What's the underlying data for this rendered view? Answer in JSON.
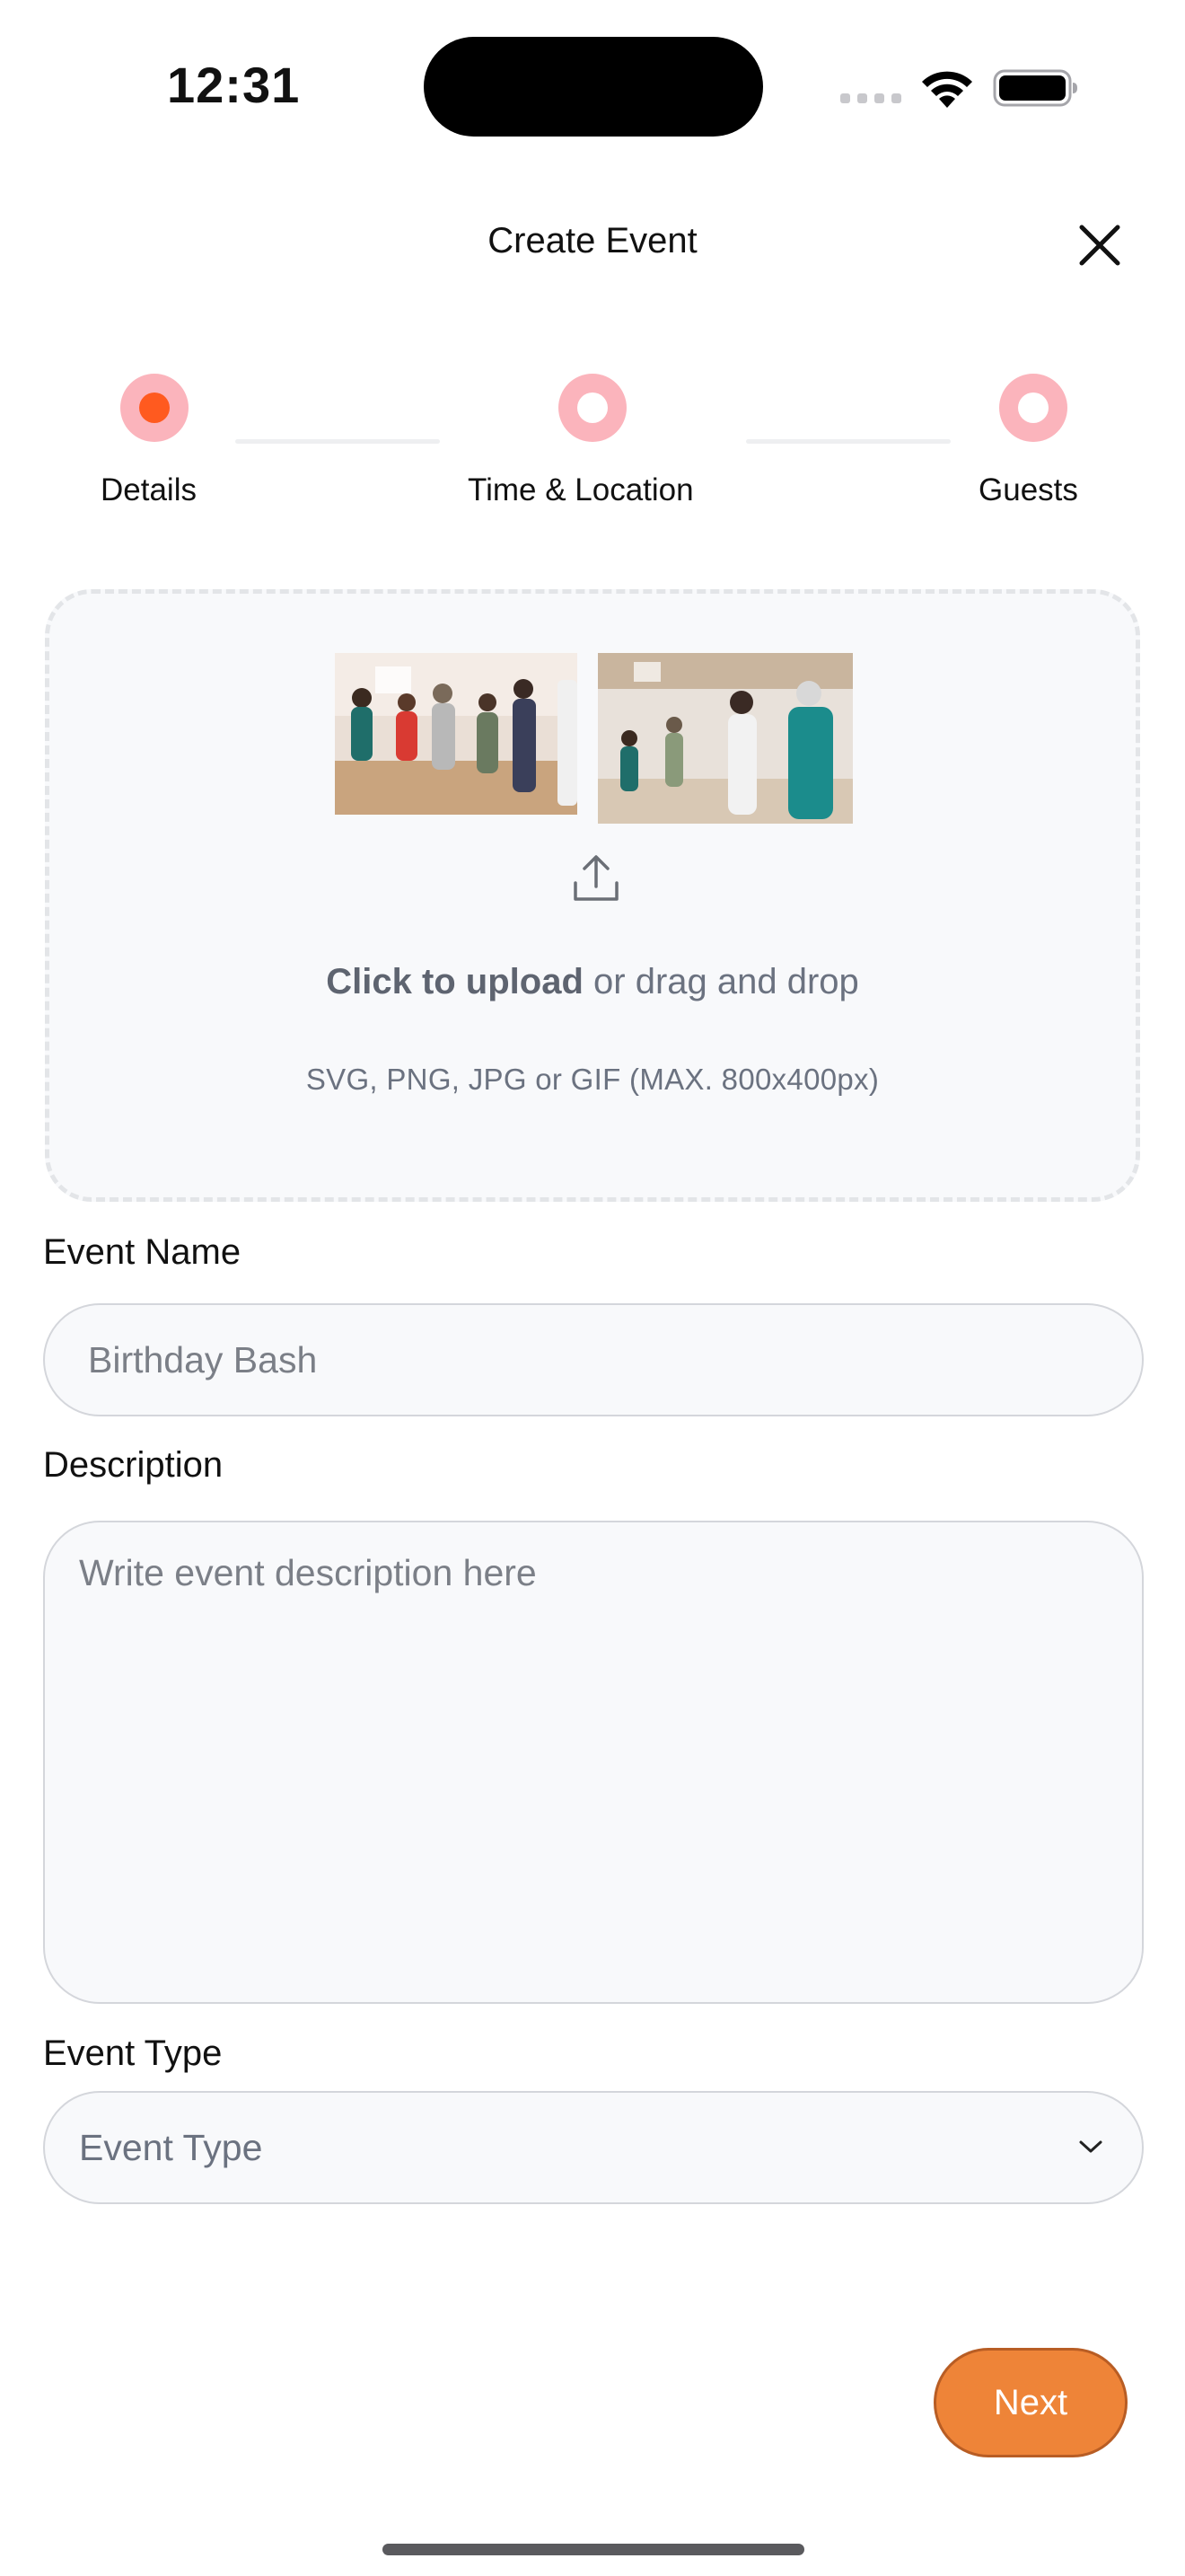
{
  "status_bar": {
    "time": "12:31"
  },
  "header": {
    "title": "Create Event",
    "close_icon": "close-icon"
  },
  "stepper": {
    "steps": [
      {
        "label": "Details",
        "state": "active"
      },
      {
        "label": "Time & Location",
        "state": "pending"
      },
      {
        "label": "Guests",
        "state": "pending"
      }
    ],
    "active_color": "#ff5a1f",
    "ring_color": "#fbb4bc"
  },
  "upload": {
    "primary_bold": "Click to upload",
    "primary_rest": " or drag and drop",
    "hint": "SVG, PNG, JPG or GIF (MAX. 800x400px)",
    "icon": "upload-icon"
  },
  "form": {
    "event_name": {
      "label": "Event Name",
      "placeholder": "Birthday Bash",
      "value": ""
    },
    "description": {
      "label": "Description",
      "placeholder": "Write event description here",
      "value": ""
    },
    "event_type": {
      "label": "Event Type",
      "selected": "Event Type",
      "icon": "chevron-down-icon"
    }
  },
  "actions": {
    "next_label": "Next",
    "next_color": "#ee8438"
  }
}
